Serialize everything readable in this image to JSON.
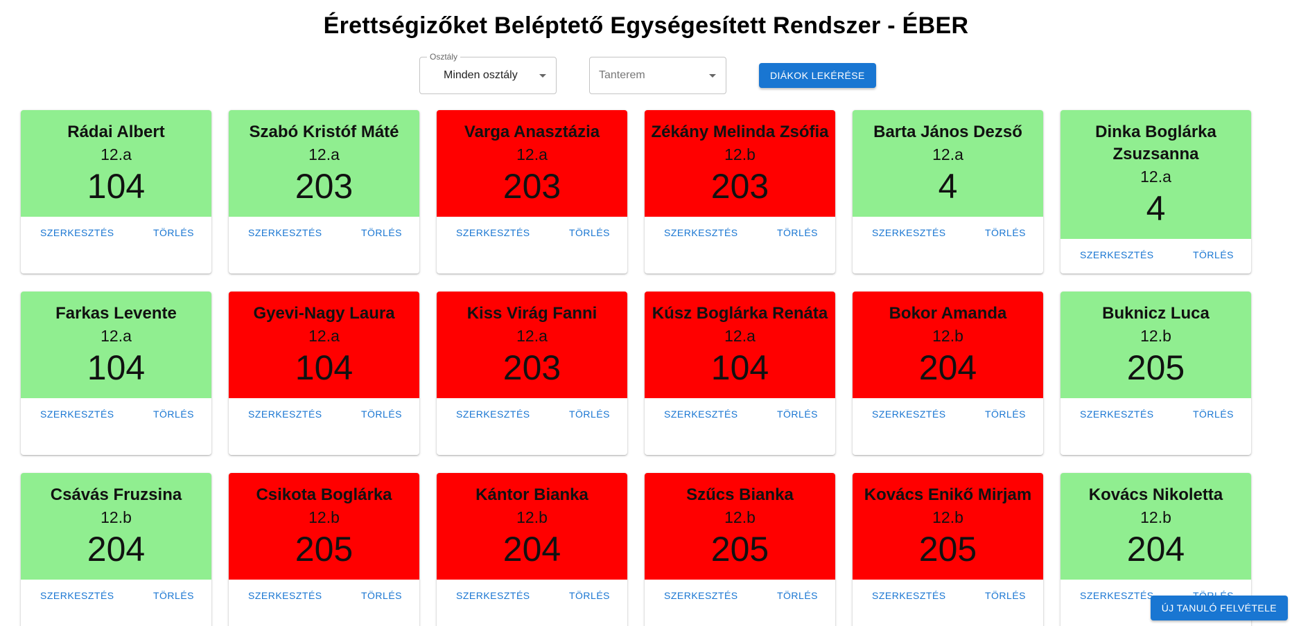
{
  "title": "Érettségizőket Beléptető Egységesített Rendszer - ÉBER",
  "filters": {
    "class_label": "Osztály",
    "class_value": "Minden osztály",
    "room_placeholder": "Tanterem",
    "fetch_button": "DIÁKOK LEKÉRÉSE"
  },
  "actions": {
    "edit": "SZERKESZTÉS",
    "delete": "TÖRLÉS"
  },
  "colors": {
    "present": "#90ee90",
    "absent": "#ff0000",
    "accent": "#1976d2"
  },
  "students": [
    {
      "name": "Rádai Albert",
      "class": "12.a",
      "room": "104",
      "status": "green"
    },
    {
      "name": "Szabó Kristóf Máté",
      "class": "12.a",
      "room": "203",
      "status": "green"
    },
    {
      "name": "Varga Anasztázia",
      "class": "12.a",
      "room": "203",
      "status": "red"
    },
    {
      "name": "Zékány Melinda Zsófia",
      "class": "12.b",
      "room": "203",
      "status": "red"
    },
    {
      "name": "Barta János Dezső",
      "class": "12.a",
      "room": "4",
      "status": "green"
    },
    {
      "name": "Dinka Boglárka Zsuzsanna",
      "class": "12.a",
      "room": "4",
      "status": "green"
    },
    {
      "name": "Farkas Levente",
      "class": "12.a",
      "room": "104",
      "status": "green"
    },
    {
      "name": "Gyevi-Nagy Laura",
      "class": "12.a",
      "room": "104",
      "status": "red"
    },
    {
      "name": "Kiss Virág Fanni",
      "class": "12.a",
      "room": "203",
      "status": "red"
    },
    {
      "name": "Kúsz Boglárka Renáta",
      "class": "12.a",
      "room": "104",
      "status": "red"
    },
    {
      "name": "Bokor Amanda",
      "class": "12.b",
      "room": "204",
      "status": "red"
    },
    {
      "name": "Buknicz Luca",
      "class": "12.b",
      "room": "205",
      "status": "green"
    },
    {
      "name": "Csávás Fruzsina",
      "class": "12.b",
      "room": "204",
      "status": "green"
    },
    {
      "name": "Csikota Boglárka",
      "class": "12.b",
      "room": "205",
      "status": "red"
    },
    {
      "name": "Kántor Bianka",
      "class": "12.b",
      "room": "204",
      "status": "red"
    },
    {
      "name": "Szűcs Bianka",
      "class": "12.b",
      "room": "205",
      "status": "red"
    },
    {
      "name": "Kovács Enikő Mirjam",
      "class": "12.b",
      "room": "205",
      "status": "red"
    },
    {
      "name": "Kovács Nikoletta",
      "class": "12.b",
      "room": "204",
      "status": "green"
    }
  ],
  "add_button": "ÚJ TANULÓ FELVÉTELE"
}
